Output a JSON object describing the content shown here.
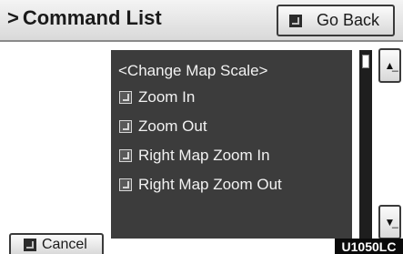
{
  "header": {
    "chevron": ">",
    "title": "Command List"
  },
  "go_back": {
    "label": "Go Back",
    "icon": "button-icon"
  },
  "list": {
    "heading": "<Change Map Scale>",
    "items": [
      {
        "label": "Zoom In",
        "icon": "voice-command-icon"
      },
      {
        "label": "Zoom Out",
        "icon": "voice-command-icon"
      },
      {
        "label": "Right Map Zoom In",
        "icon": "voice-command-icon"
      },
      {
        "label": "Right Map Zoom Out",
        "icon": "voice-command-icon"
      }
    ]
  },
  "scroll": {
    "up_glyph": "▲̲",
    "down_glyph": "▼̲"
  },
  "cancel": {
    "label": "Cancel",
    "icon": "button-icon"
  },
  "figure_code": "U1050LC",
  "colors": {
    "panel": "#3c3c3c",
    "header_bg": "#e6e6e6",
    "text_light": "#f2f2f2",
    "label_bg": "#0a0a0a"
  }
}
